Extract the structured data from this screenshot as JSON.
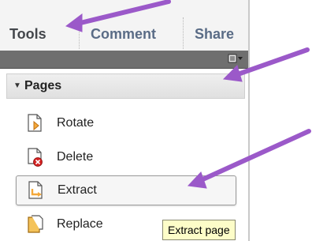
{
  "tabs": [
    {
      "label": "Tools",
      "active": true
    },
    {
      "label": "Comment",
      "active": false
    },
    {
      "label": "Share",
      "active": false
    }
  ],
  "section": {
    "title": "Pages",
    "expanded": true
  },
  "tools": [
    {
      "label": "Rotate",
      "icon": "rotate-page-icon",
      "selected": false
    },
    {
      "label": "Delete",
      "icon": "delete-page-icon",
      "selected": false
    },
    {
      "label": "Extract",
      "icon": "extract-page-icon",
      "selected": true
    },
    {
      "label": "Replace",
      "icon": "replace-page-icon",
      "selected": false
    }
  ],
  "tooltip": {
    "text": "Extract page"
  },
  "colors": {
    "annotation_arrow": "#9b59c9",
    "tooltip_bg": "#fdfdc8",
    "tab_text": "#5a6c86"
  }
}
